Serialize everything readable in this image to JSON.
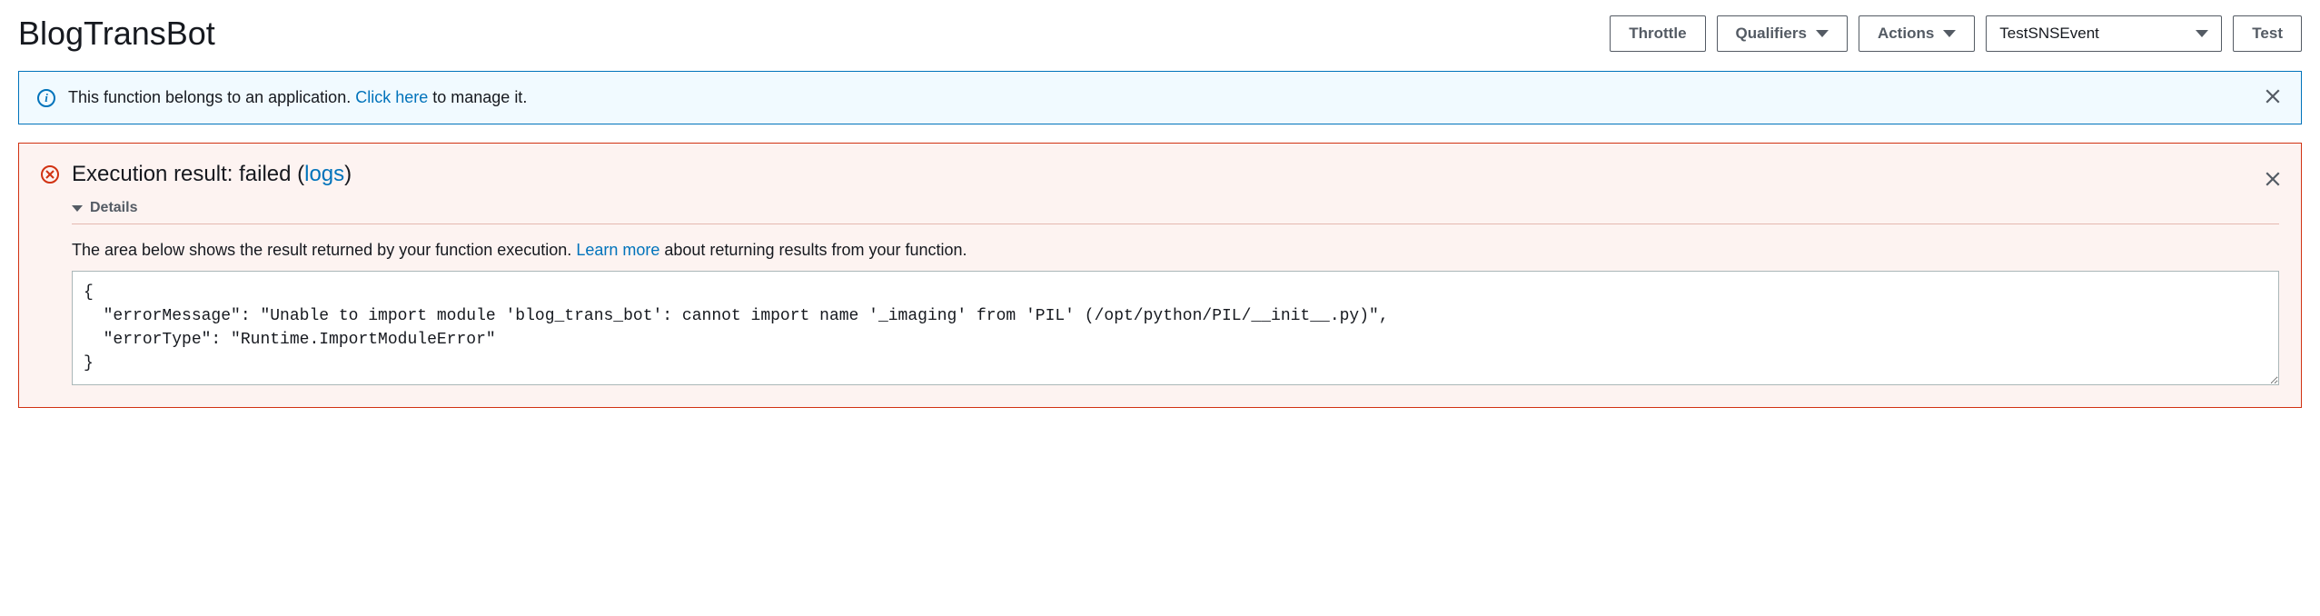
{
  "header": {
    "title": "BlogTransBot",
    "throttle_label": "Throttle",
    "qualifiers_label": "Qualifiers",
    "actions_label": "Actions",
    "event_selected": "TestSNSEvent",
    "test_label": "Test"
  },
  "info_banner": {
    "text_before": "This function belongs to an application. ",
    "link_text": "Click here",
    "text_after": " to manage it."
  },
  "error_banner": {
    "title_prefix": "Execution result: failed (",
    "title_link": "logs",
    "title_suffix": ")",
    "details_label": "Details",
    "desc_before": "The area below shows the result returned by your function execution. ",
    "desc_link": "Learn more",
    "desc_after": " about returning results from your function.",
    "code": "{\n  \"errorMessage\": \"Unable to import module 'blog_trans_bot': cannot import name '_imaging' from 'PIL' (/opt/python/PIL/__init__.py)\",\n  \"errorType\": \"Runtime.ImportModuleError\"\n}"
  }
}
